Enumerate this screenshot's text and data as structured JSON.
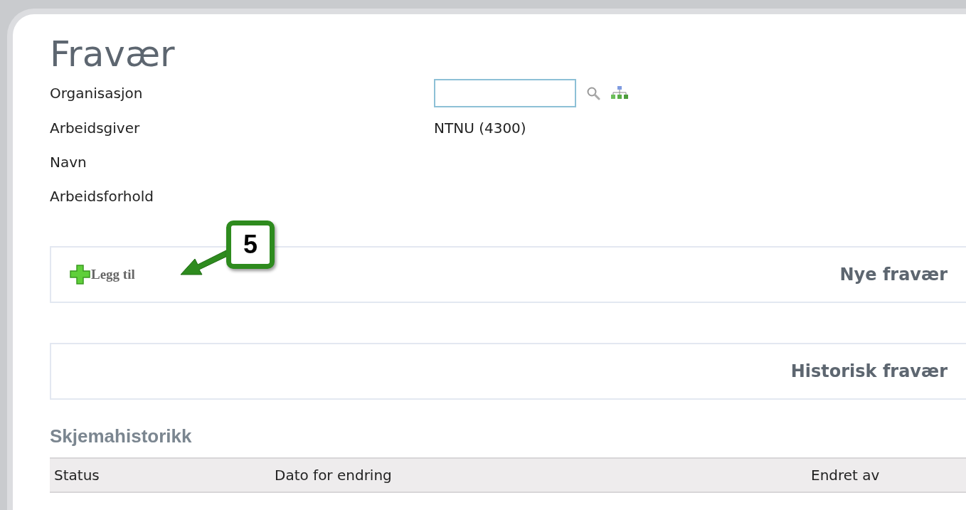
{
  "page": {
    "title": "Fravær"
  },
  "form": {
    "fields": [
      {
        "label": "Organisasjon",
        "kind": "search"
      },
      {
        "label": "Arbeidsgiver",
        "kind": "text",
        "value": "NTNU (4300)"
      },
      {
        "label": "Navn",
        "kind": "text"
      },
      {
        "label": "Arbeidsforhold",
        "kind": "text"
      }
    ]
  },
  "new_section": {
    "add_button": "Legg til",
    "title": "Nye fravær"
  },
  "callout": {
    "number": "5"
  },
  "history_section": {
    "title": "Historisk fravær"
  },
  "form_history": {
    "title": "Skjemahistorikk",
    "columns": [
      "Status",
      "Dato for endring",
      "Endret av"
    ]
  }
}
